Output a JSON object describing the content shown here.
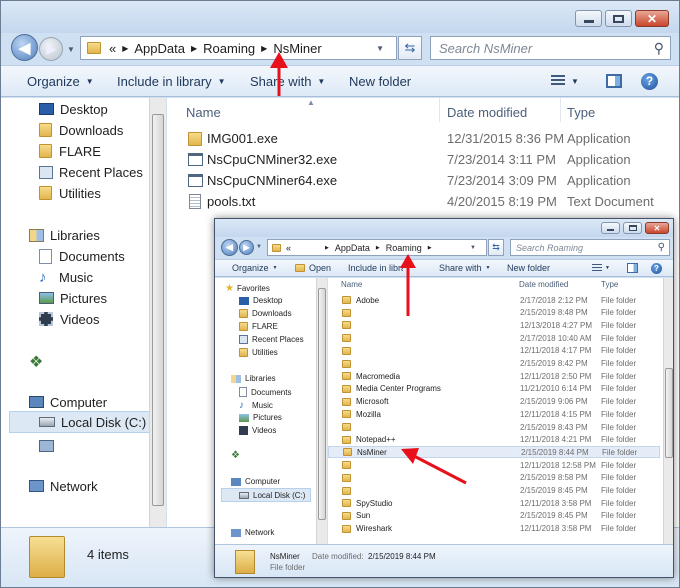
{
  "main": {
    "address": {
      "chevrons": "«",
      "parts": [
        "AppData",
        "Roaming",
        "NsMiner"
      ]
    },
    "search_placeholder": "Search NsMiner",
    "toolbar": {
      "organize": "Organize",
      "include": "Include in library",
      "share": "Share with",
      "newfolder": "New folder"
    },
    "nav": {
      "desktop": "Desktop",
      "downloads": "Downloads",
      "flare": "FLARE",
      "recent": "Recent Places",
      "utilities": "Utilities",
      "libraries": "Libraries",
      "documents": "Documents",
      "music": "Music",
      "pictures": "Pictures",
      "videos": "Videos",
      "computer": "Computer",
      "localdisk": "Local Disk (C:)",
      "network": "Network"
    },
    "columns": {
      "name": "Name",
      "date": "Date modified",
      "type": "Type"
    },
    "files": [
      {
        "name": "IMG001.exe",
        "date": "12/31/2015 8:36 PM",
        "type": "Application",
        "icon": "folder-icon"
      },
      {
        "name": "NsCpuCNMiner32.exe",
        "date": "7/23/2014 3:11 PM",
        "type": "Application",
        "icon": "app-icon"
      },
      {
        "name": "NsCpuCNMiner64.exe",
        "date": "7/23/2014 3:09 PM",
        "type": "Application",
        "icon": "app-icon"
      },
      {
        "name": "pools.txt",
        "date": "4/20/2015 8:19 PM",
        "type": "Text Document",
        "icon": "text-file-icon"
      }
    ],
    "status": "4 items"
  },
  "inner": {
    "address": {
      "chevrons": "«",
      "parts": [
        "AppData",
        "Roaming"
      ]
    },
    "search_placeholder": "Search Roaming",
    "toolbar": {
      "organize": "Organize",
      "open": "Open",
      "include": "Include in library",
      "share": "Share with",
      "newfolder": "New folder"
    },
    "nav": {
      "favorites": "Favorites",
      "desktop": "Desktop",
      "downloads": "Downloads",
      "flare": "FLARE",
      "recent": "Recent Places",
      "utilities": "Utilities",
      "libraries": "Libraries",
      "documents": "Documents",
      "music": "Music",
      "pictures": "Pictures",
      "videos": "Videos",
      "computer": "Computer",
      "localdisk": "Local Disk (C:)",
      "network": "Network"
    },
    "columns": {
      "name": "Name",
      "date": "Date modified",
      "type": "Type"
    },
    "rows": [
      {
        "name": "Adobe",
        "date": "2/17/2018 2:12 PM",
        "type": "File folder"
      },
      {
        "name": "",
        "date": "2/15/2019 8:48 PM",
        "type": "File folder"
      },
      {
        "name": "",
        "date": "12/13/2018 4:27 PM",
        "type": "File folder"
      },
      {
        "name": "",
        "date": "2/17/2018 10:40 AM",
        "type": "File folder"
      },
      {
        "name": "",
        "date": "12/11/2018 4:17 PM",
        "type": "File folder"
      },
      {
        "name": "",
        "date": "2/15/2019 8:42 PM",
        "type": "File folder"
      },
      {
        "name": "Macromedia",
        "date": "12/11/2018 2:50 PM",
        "type": "File folder"
      },
      {
        "name": "Media Center Programs",
        "date": "11/21/2010 6:14 PM",
        "type": "File folder"
      },
      {
        "name": "Microsoft",
        "date": "2/15/2019 9:06 PM",
        "type": "File folder"
      },
      {
        "name": "Mozilla",
        "date": "12/11/2018 4:15 PM",
        "type": "File folder"
      },
      {
        "name": "",
        "date": "2/15/2019 8:43 PM",
        "type": "File folder"
      },
      {
        "name": "Notepad++",
        "date": "12/11/2018 4:21 PM",
        "type": "File folder"
      },
      {
        "name": "NsMiner",
        "date": "2/15/2019 8:44 PM",
        "type": "File folder"
      },
      {
        "name": "",
        "date": "12/11/2018 12:58 PM",
        "type": "File folder"
      },
      {
        "name": "",
        "date": "2/15/2019 8:58 PM",
        "type": "File folder"
      },
      {
        "name": "",
        "date": "2/15/2019 8:45 PM",
        "type": "File folder"
      },
      {
        "name": "SpyStudio",
        "date": "12/11/2018 3:58 PM",
        "type": "File folder"
      },
      {
        "name": "Sun",
        "date": "2/15/2019 8:45 PM",
        "type": "File folder"
      },
      {
        "name": "Wireshark",
        "date": "12/11/2018 3:58 PM",
        "type": "File folder"
      }
    ],
    "details": {
      "name": "NsMiner",
      "date_label": "Date modified:",
      "date": "2/15/2019 8:44 PM",
      "type": "File folder"
    }
  },
  "colors": {
    "arrow": "#e8101a",
    "accent": "#1e395b"
  }
}
